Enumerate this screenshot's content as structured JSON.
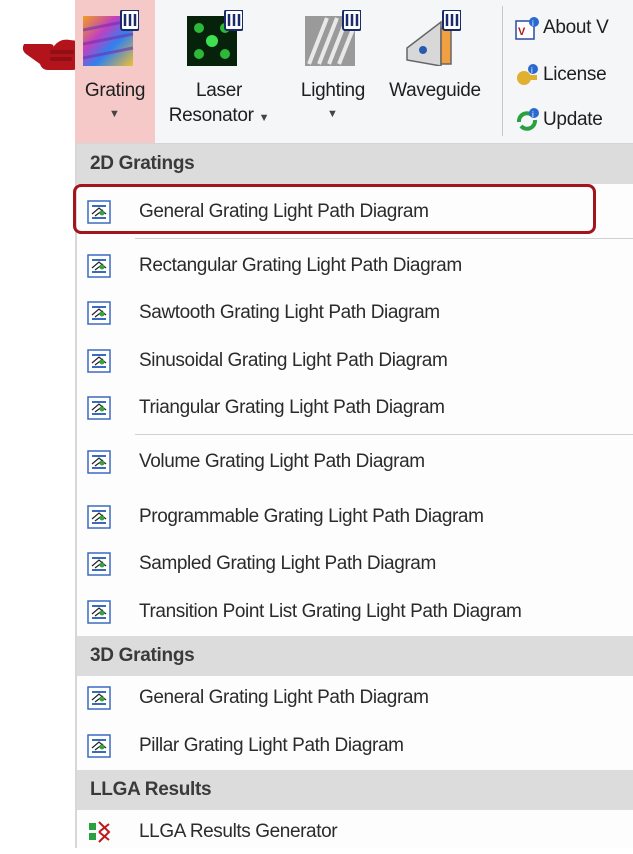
{
  "ribbon": {
    "buttons": [
      {
        "label1": "Grating",
        "label2": "",
        "icon": "grating-icon",
        "active": true
      },
      {
        "label1": "Laser",
        "label2": "Resonator",
        "icon": "laser-resonator-icon",
        "active": false
      },
      {
        "label1": "Lighting",
        "label2": "",
        "icon": "lighting-icon",
        "active": false
      },
      {
        "label1": "Waveguide",
        "label2": "",
        "icon": "waveguide-icon",
        "active": false
      }
    ],
    "small": [
      {
        "label": "About V",
        "icon": "about-icon"
      },
      {
        "label": "License",
        "icon": "license-icon"
      },
      {
        "label": "Update",
        "icon": "update-icon"
      }
    ]
  },
  "menu": {
    "sections": [
      {
        "title": "2D Gratings",
        "items": [
          "General Grating Light Path Diagram",
          "Rectangular Grating Light Path Diagram",
          "Sawtooth Grating Light Path Diagram",
          "Sinusoidal Grating Light Path Diagram",
          "Triangular Grating Light Path Diagram",
          "Volume Grating Light Path Diagram",
          "Programmable Grating Light Path Diagram",
          "Sampled Grating Light Path Diagram",
          "Transition Point List Grating Light Path Diagram"
        ]
      },
      {
        "title": "3D Gratings",
        "items": [
          "General Grating Light Path Diagram",
          "Pillar Grating Light Path Diagram"
        ]
      },
      {
        "title": "LLGA Results",
        "items": [
          "LLGA Results Generator"
        ]
      }
    ]
  },
  "colors": {
    "active_tab": "#f6c9c9",
    "highlight": "#a3151c",
    "pointer": "#b3141c",
    "section_header": "#dcdcdc"
  }
}
